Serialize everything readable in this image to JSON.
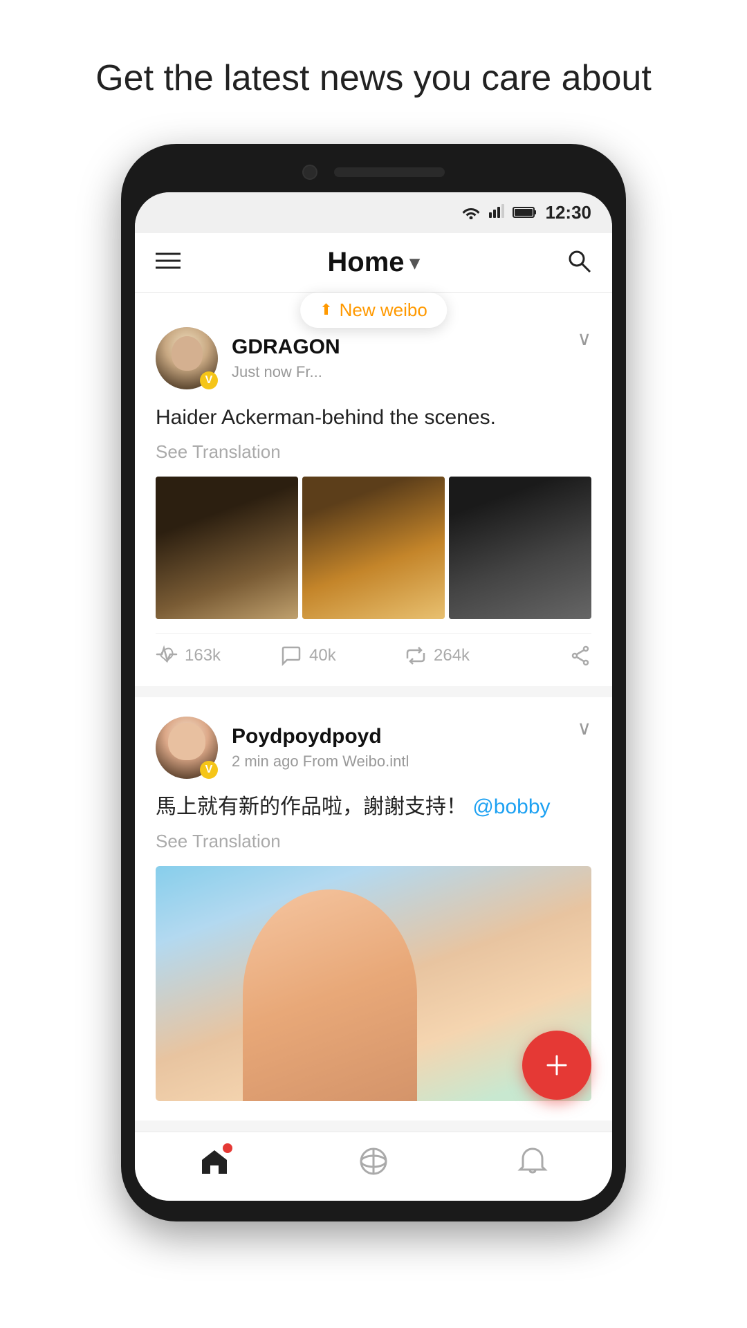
{
  "page": {
    "headline": "Get the latest news you care about"
  },
  "status_bar": {
    "time": "12:30"
  },
  "header": {
    "title": "Home",
    "hamburger_label": "menu",
    "search_label": "search"
  },
  "new_weibo_badge": {
    "label": "New weibo"
  },
  "posts": [
    {
      "id": "post1",
      "username": "GDRAGON",
      "meta": "Just now  Fr...",
      "content": "Haider Ackerman-behind the scenes.",
      "see_translation": "See Translation",
      "likes": "163k",
      "comments": "40k",
      "reposts": "264k",
      "has_images": true
    },
    {
      "id": "post2",
      "username": "Poydpoydpoyd",
      "meta": "2 min ago   From Weibo.intl",
      "content": "馬上就有新的作品啦，謝謝支持！",
      "mention": "@bobby",
      "see_translation": "See Translation",
      "has_image": true
    }
  ],
  "bottom_nav": {
    "home_label": "home",
    "discover_label": "discover",
    "notifications_label": "notifications"
  },
  "fab": {
    "label": "compose"
  }
}
